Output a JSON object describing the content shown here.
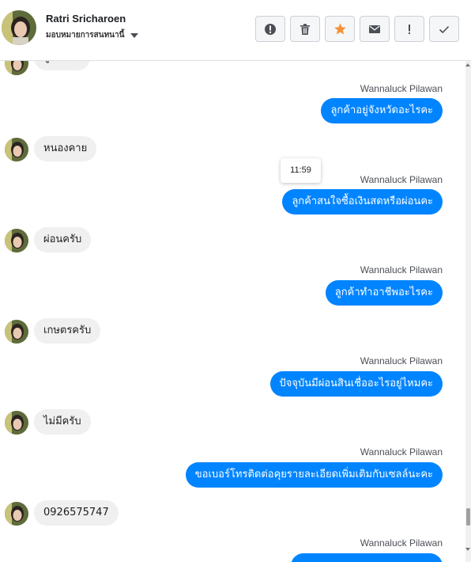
{
  "header": {
    "contact_name": "Ratri Sricharoen",
    "assign_label": "มอบหมายการสนทนานี้"
  },
  "toolbar": {
    "buttons": [
      {
        "icon": "alert-circle-icon"
      },
      {
        "icon": "trash-icon"
      },
      {
        "icon": "star-icon"
      },
      {
        "icon": "envelope-icon"
      },
      {
        "icon": "exclamation-icon"
      },
      {
        "icon": "checkmark-icon"
      }
    ]
  },
  "colors": {
    "outgoing_bubble": "#0084ff",
    "incoming_bubble": "#f1f0f0",
    "star": "#f7923a"
  },
  "tooltip": "11:59",
  "messages": {
    "in_partial": "ผู้ใช้ครับ",
    "out_1": {
      "sender": "Wannaluck Pilawan",
      "text": "ลูกค้าอยู่จังหวัดอะไรคะ"
    },
    "in_1": "หนองคาย",
    "out_2": {
      "sender": "Wannaluck Pilawan",
      "text": "ลูกค้าสนใจซื้อเงินสดหรือผ่อนคะ"
    },
    "in_2": "ผ่อนครับ",
    "out_3": {
      "sender": "Wannaluck Pilawan",
      "text": "ลูกค้าทำอาชีพอะไรคะ"
    },
    "in_3": "เกษตรครับ",
    "out_4": {
      "sender": "Wannaluck Pilawan",
      "text": "ปัจจุบันมีผ่อนสินเชื่ออะไรอยู่ไหมคะ"
    },
    "in_4": "ไม่มีครับ",
    "out_5": {
      "sender": "Wannaluck Pilawan",
      "text": "ขอเบอร์โทรติดต่อคุยรายละเอียดเพิ่มเติมกับเซลล์นะคะ"
    },
    "in_5": "0926575747",
    "out_6": {
      "sender": "Wannaluck Pilawan",
      "text": ""
    }
  }
}
